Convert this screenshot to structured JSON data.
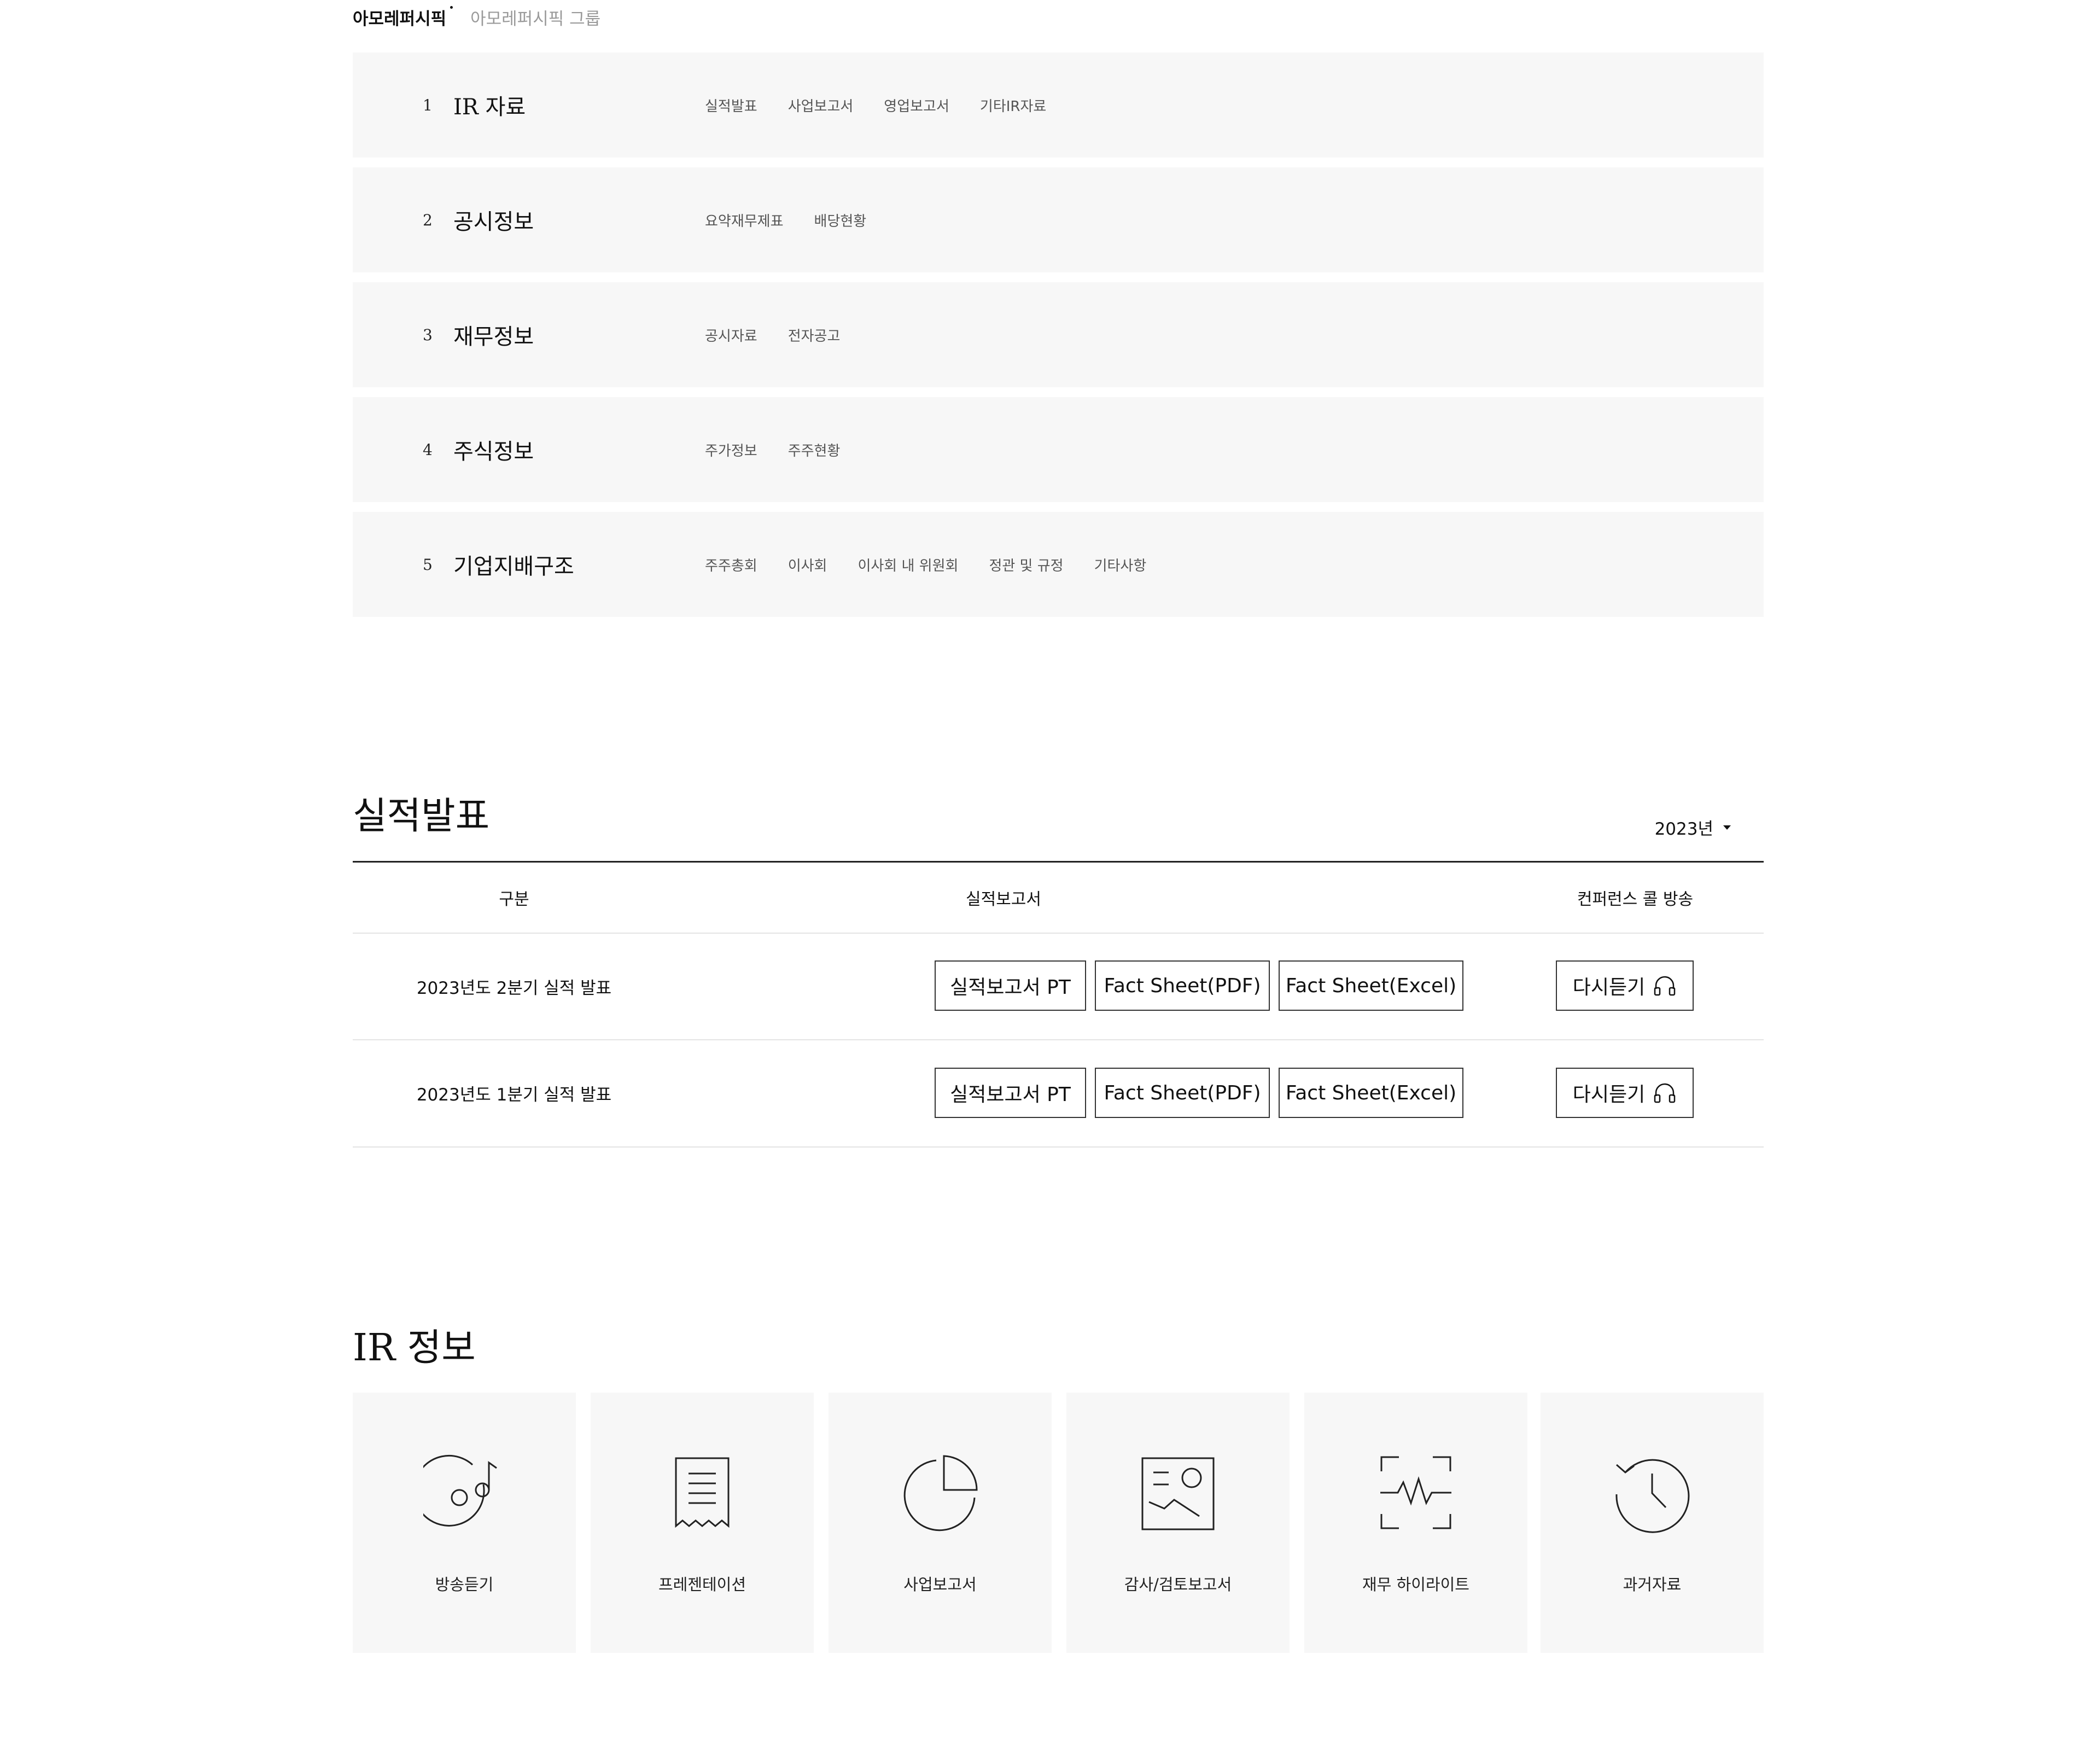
{
  "group_tabs": [
    {
      "label": "아모레퍼시픽",
      "active": true
    },
    {
      "label": "아모레퍼시픽 그룹",
      "active": false
    }
  ],
  "menu": [
    {
      "num": "1",
      "title": "IR 자료",
      "subs": [
        "실적발표",
        "사업보고서",
        "영업보고서",
        "기타IR자료"
      ]
    },
    {
      "num": "2",
      "title": "공시정보",
      "subs": [
        "요약재무제표",
        "배당현황"
      ]
    },
    {
      "num": "3",
      "title": "재무정보",
      "subs": [
        "공시자료",
        "전자공고"
      ]
    },
    {
      "num": "4",
      "title": "주식정보",
      "subs": [
        "주가정보",
        "주주현황"
      ]
    },
    {
      "num": "5",
      "title": "기업지배구조",
      "subs": [
        "주주총회",
        "이사회",
        "이사회 내 위원회",
        "정관 및 규정",
        "기타사항"
      ]
    }
  ],
  "earnings": {
    "title": "실적발표",
    "year_selected": "2023년",
    "headers": {
      "category": "구분",
      "report": "실적보고서",
      "call": "컨퍼런스 콜 방송"
    },
    "rows": [
      {
        "label": "2023년도 2분기 실적 발표",
        "btn_pt": "실적보고서 PT",
        "btn_pdf": "Fact Sheet(PDF)",
        "btn_excel": "Fact Sheet(Excel)",
        "btn_listen": "다시듣기"
      },
      {
        "label": "2023년도 1분기 실적 발표",
        "btn_pt": "실적보고서 PT",
        "btn_pdf": "Fact Sheet(PDF)",
        "btn_excel": "Fact Sheet(Excel)",
        "btn_listen": "다시듣기"
      }
    ]
  },
  "ir_info": {
    "title": "IR 정보",
    "cards": [
      {
        "label": "방송듣기",
        "icon": "music-disc-icon"
      },
      {
        "label": "프레젠테이션",
        "icon": "receipt-document-icon"
      },
      {
        "label": "사업보고서",
        "icon": "pie-chart-icon"
      },
      {
        "label": "감사/검토보고서",
        "icon": "image-report-icon"
      },
      {
        "label": "재무 하이라이트",
        "icon": "pulse-scan-icon"
      },
      {
        "label": "과거자료",
        "icon": "history-clock-icon"
      }
    ]
  },
  "colors": {
    "panel_bg": "#f7f7f7",
    "text": "#111111",
    "sub_text": "#555555",
    "muted": "#9a9a9a"
  }
}
